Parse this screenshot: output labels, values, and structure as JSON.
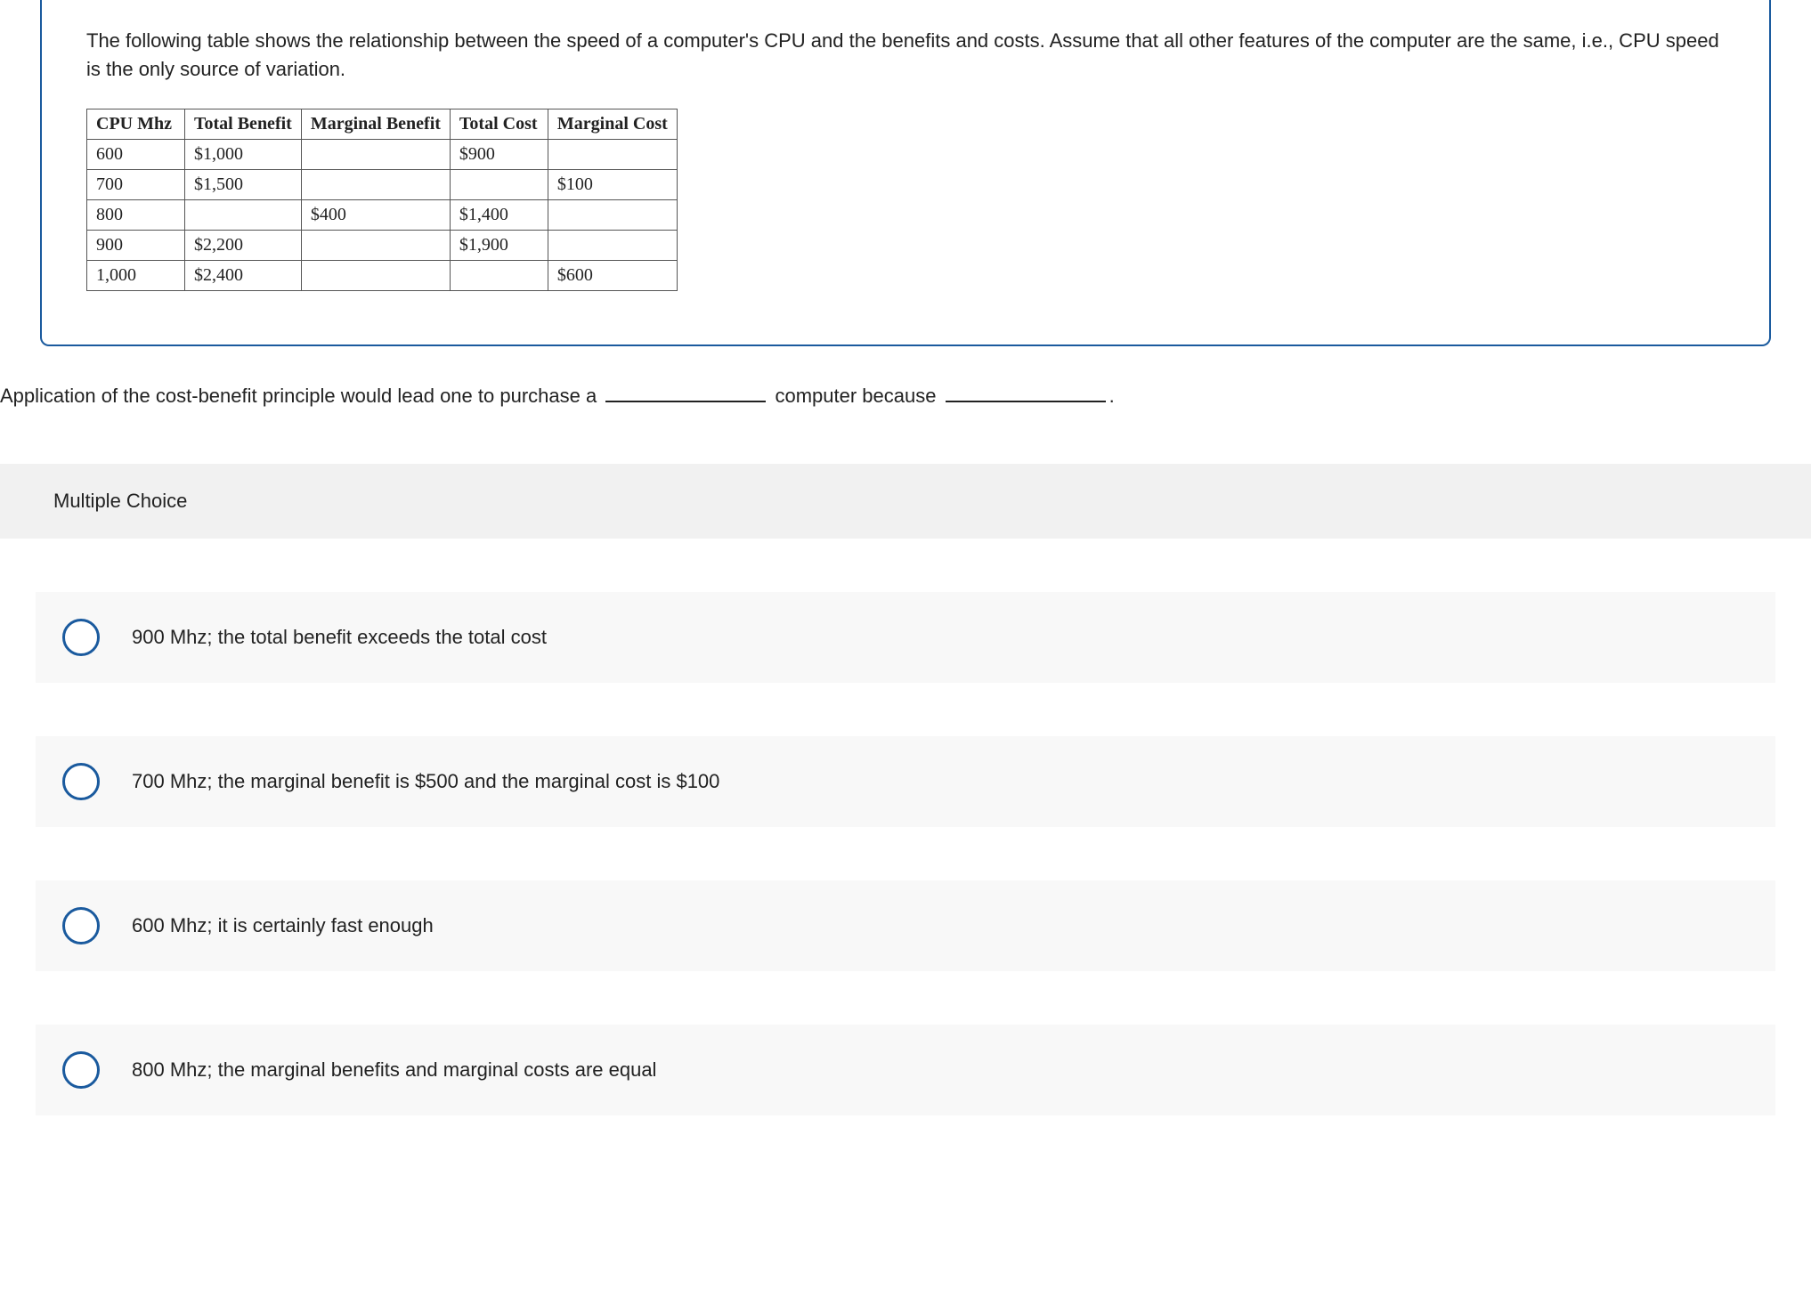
{
  "question": {
    "intro": "The following table shows the relationship between the speed of a computer's CPU and the benefits and costs. Assume that all other features of the computer are the same, i.e., CPU speed is the only source of variation.",
    "table": {
      "headers": [
        "CPU Mhz",
        "Total Benefit",
        "Marginal Benefit",
        "Total Cost",
        "Marginal Cost"
      ],
      "rows": [
        [
          "600",
          "$1,000",
          "",
          "$900",
          ""
        ],
        [
          "700",
          "$1,500",
          "",
          "",
          "$100"
        ],
        [
          "800",
          "",
          "$400",
          "$1,400",
          ""
        ],
        [
          "900",
          "$2,200",
          "",
          "$1,900",
          ""
        ],
        [
          "1,000",
          "$2,400",
          "",
          "",
          "$600"
        ]
      ]
    },
    "prompt_part1": "Application of the cost-benefit principle would lead one to purchase a",
    "prompt_part2": "computer because",
    "prompt_end": "."
  },
  "mc_label": "Multiple Choice",
  "choices": [
    "900 Mhz; the total benefit exceeds the total cost",
    "700 Mhz; the marginal benefit is $500 and the marginal cost is $100",
    "600 Mhz; it is certainly fast enough",
    "800 Mhz; the marginal benefits and marginal costs are equal"
  ]
}
